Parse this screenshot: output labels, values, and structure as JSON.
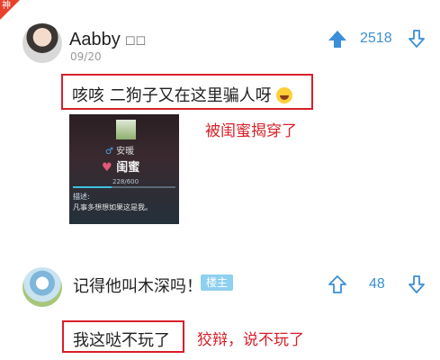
{
  "corner_badge": "神",
  "post": {
    "username": "Aabby",
    "username_suffix": "☐☐",
    "date": "09/20",
    "vote_count": "2518",
    "comment_text": "咳咳   二狗子又在这里骗人呀",
    "annotation": "被闺蜜揭穿了",
    "screenshot": {
      "name": "安暖",
      "relation": "闺蜜",
      "progress": "228/600",
      "progress_value": 0.38,
      "desc_title": "描述:",
      "desc_body": "凡事多想想如果这是我。"
    }
  },
  "reply": {
    "comment_text": "记得他叫木深吗！",
    "tag": "楼主",
    "vote_count": "48",
    "boxed_text": "我这哒不玩了",
    "annotation": "狡辩，说不玩了"
  },
  "colors": {
    "accent": "#3b8fd8",
    "highlight": "#d8202a",
    "tag": "#8ed0ef"
  },
  "icons": [
    "upvote-icon",
    "downvote-icon",
    "grin-emoji-icon",
    "male-icon",
    "heart-icon"
  ]
}
